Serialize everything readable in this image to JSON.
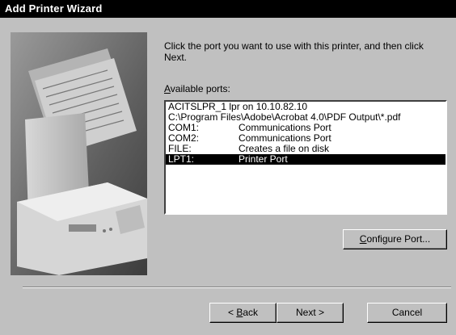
{
  "window": {
    "title": "Add Printer Wizard"
  },
  "instruction": "Click the port you want to use with this printer, and then click Next.",
  "ports_label": {
    "accel": "A",
    "rest": "vailable ports:"
  },
  "ports": [
    {
      "name": "ACITSLPR_1 lpr on 10.10.82.10",
      "desc": ""
    },
    {
      "name": "C:\\Program Files\\Adobe\\Acrobat 4.0\\PDF Output\\*.pdf",
      "desc": ""
    },
    {
      "name": "COM1:",
      "desc": "Communications Port"
    },
    {
      "name": "COM2:",
      "desc": "Communications Port"
    },
    {
      "name": "FILE:",
      "desc": "Creates a file on disk"
    },
    {
      "name": "LPT1:",
      "desc": "Printer Port",
      "selected": true
    }
  ],
  "buttons": {
    "configure": {
      "accel": "C",
      "rest": "onfigure Port..."
    },
    "back": {
      "prefix": "< ",
      "accel": "B",
      "rest": "ack"
    },
    "next": "Next >",
    "cancel": "Cancel"
  },
  "colors": {
    "selection": "#000000",
    "face": "#c0c0c0",
    "titlebar": "#000000"
  }
}
